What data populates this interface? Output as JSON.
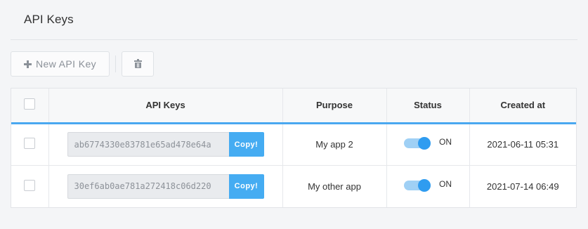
{
  "page": {
    "title": "API Keys"
  },
  "toolbar": {
    "new_key_label": "New API Key",
    "new_key_icon": "plus-icon",
    "delete_icon": "trash-icon"
  },
  "table": {
    "columns": [
      "API Keys",
      "Purpose",
      "Status",
      "Created at"
    ],
    "header_accent_color": "#4aa8f0",
    "rows": [
      {
        "api_key": "ab6774330e83781e65ad478e64a",
        "copy_label": "Copy!",
        "purpose": "My app 2",
        "status": "ON",
        "status_on": true,
        "created_at": "2021-06-11 05:31"
      },
      {
        "api_key": "30ef6ab0ae781a272418c06d220",
        "copy_label": "Copy!",
        "purpose": "My other app",
        "status": "ON",
        "status_on": true,
        "created_at": "2021-07-14 06:49"
      }
    ]
  },
  "colors": {
    "copy_button": "#45acf2",
    "toggle_knob": "#2f9cf0",
    "toggle_track": "#9fd0f5"
  }
}
